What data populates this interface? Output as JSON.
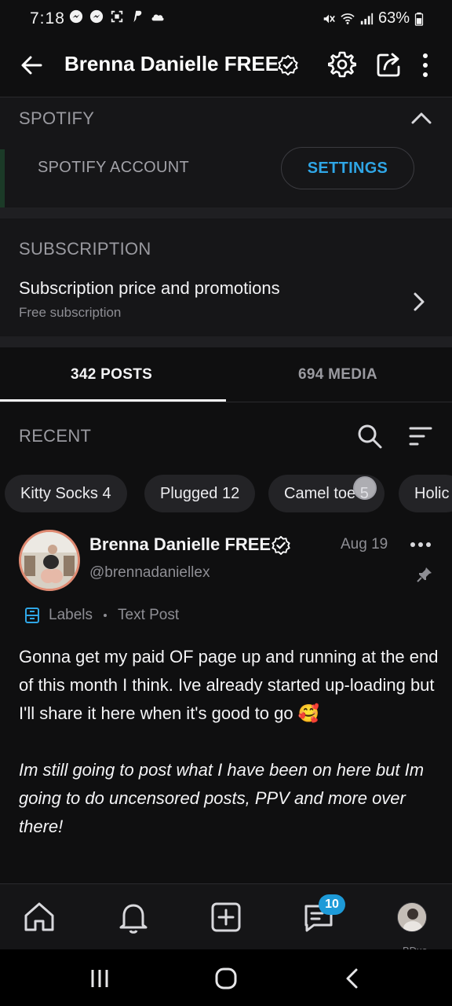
{
  "status_bar": {
    "time": "7:18",
    "battery": "63%",
    "left_icons": [
      "messenger-icon",
      "messenger-icon",
      "screenshot-icon",
      "paypal-icon",
      "cloud-icon"
    ],
    "right_icons": [
      "mute-icon",
      "wifi-icon",
      "signal-icon",
      "battery-icon"
    ]
  },
  "header": {
    "title": "Brenna Danielle FREE",
    "icons": [
      "back-arrow-icon",
      "verified-icon",
      "gear-icon",
      "share-icon",
      "more-vertical-icon"
    ]
  },
  "spotify": {
    "section_title": "SPOTIFY",
    "account_label": "SPOTIFY ACCOUNT",
    "settings_button": "SETTINGS"
  },
  "subscription": {
    "section_title": "SUBSCRIPTION",
    "row_title": "Subscription price and promotions",
    "row_subtitle": "Free subscription"
  },
  "tabs": [
    {
      "label": "342 POSTS",
      "active": true
    },
    {
      "label": "694 MEDIA",
      "active": false
    }
  ],
  "recent": {
    "label": "RECENT"
  },
  "chips": [
    {
      "label": "Kitty Socks 4"
    },
    {
      "label": "Plugged 12"
    },
    {
      "label": "Camel toe 5"
    },
    {
      "label": "Holic"
    }
  ],
  "post": {
    "author_name": "Brenna Danielle FREE",
    "handle": "@brennadaniellex",
    "date": "Aug 19",
    "labels_text": "Labels",
    "post_type": "Text Post",
    "body_paragraph_1": "Gonna get my paid OF page up and running at the end of this month I think. Ive already started up-loading but I'll share it here when it's good to go 🥰",
    "body_paragraph_2": "Im still going to post what I have been on here but Im going to do uncensored posts, PPV and more over there!"
  },
  "bottom_nav": {
    "items": [
      "home-icon",
      "bell-icon",
      "add-post-icon",
      "messages-icon",
      "profile-avatar"
    ],
    "messages_badge": "10"
  },
  "watermark": "BDxo",
  "colors": {
    "background": "#0f0f10",
    "surface": "#161618",
    "accent_blue": "#2fa6e6",
    "muted_text": "#9a9aa0"
  }
}
